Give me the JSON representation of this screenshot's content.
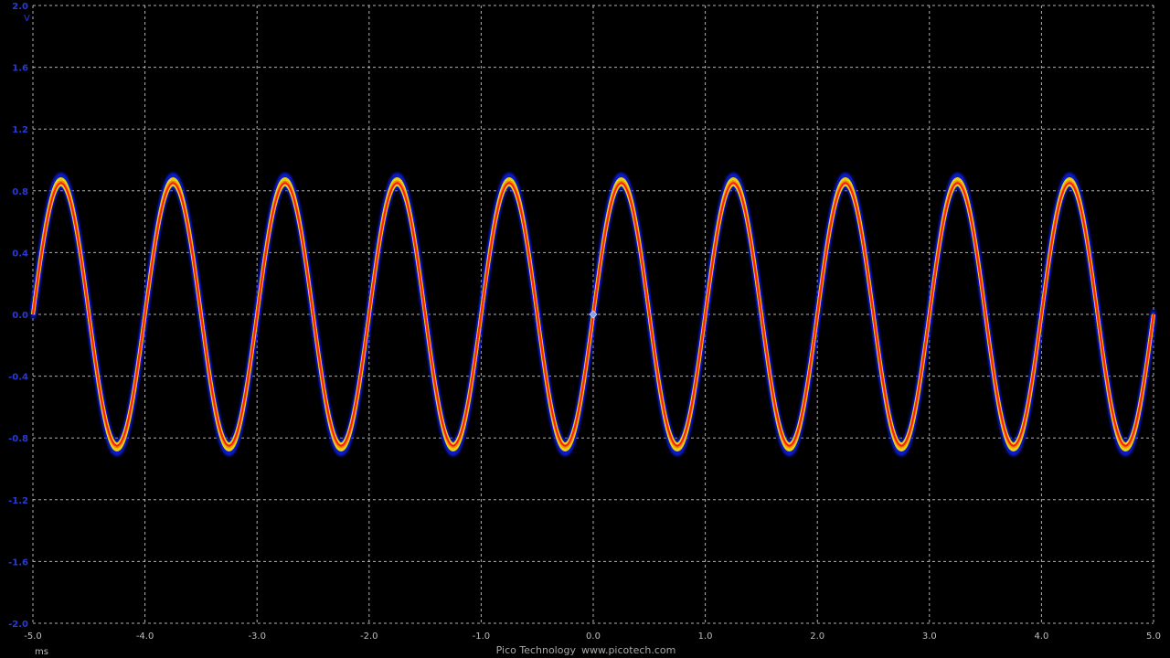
{
  "chart_data": {
    "type": "line",
    "xlabel": "",
    "ylabel": "",
    "x_unit": "ms",
    "y_unit": "V",
    "xlim": [
      -5.0,
      5.0
    ],
    "ylim": [
      -2.0,
      2.0
    ],
    "x_ticks": [
      "-5.0",
      "-4.0",
      "-3.0",
      "-2.0",
      "-1.0",
      "0.0",
      "1.0",
      "2.0",
      "3.0",
      "4.0",
      "5.0"
    ],
    "y_ticks": [
      "2.0",
      "1.6",
      "1.2",
      "0.8",
      "0.4",
      "0.0",
      "-0.4",
      "-0.8",
      "-1.2",
      "-1.6",
      "-2.0"
    ],
    "grid": true,
    "persistence_display": true,
    "series": [
      {
        "waveform": "sine",
        "frequency_khz": 1.0,
        "amplitude_v": 0.85,
        "offset_v": 0.0,
        "phase_deg": 0,
        "colors": [
          "#1020ff",
          "#ffe800",
          "#ff1a1a"
        ]
      }
    ],
    "trigger_marker": {
      "x": 0.0,
      "y": 0.0
    }
  },
  "footer": {
    "brand": "Pico Technology",
    "url": "www.picotech.com"
  },
  "colors": {
    "background": "#000000",
    "grid": "#d0d0d0",
    "y_axis_label": "#2a3ad8",
    "x_axis_label": "#bdbdbd"
  }
}
